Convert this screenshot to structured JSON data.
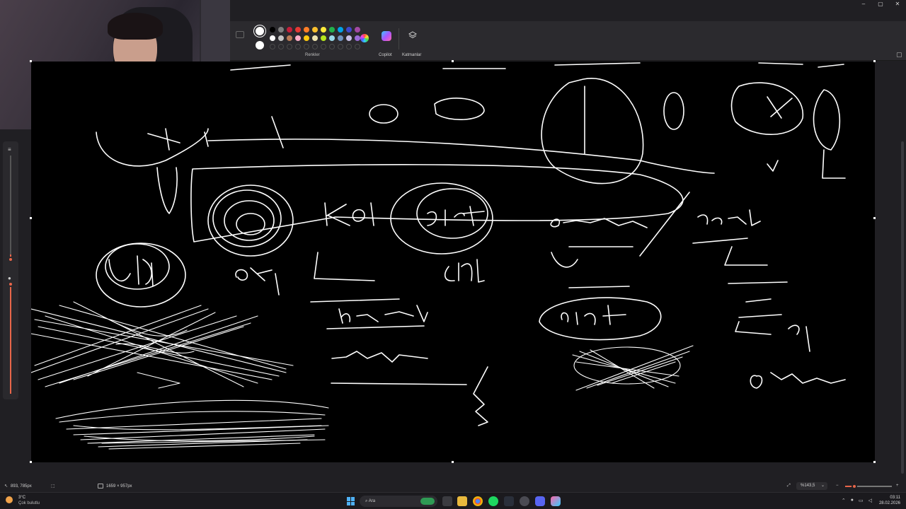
{
  "window": {
    "controls": [
      "–",
      "▢",
      "✕"
    ]
  },
  "ribbon": {
    "colors_label": "Renkler",
    "copilot_label": "Copilot",
    "layers_label": "Katmanlar",
    "palette": [
      "#000000",
      "#7f7f7f",
      "#c41e3a",
      "#e53935",
      "#ff7f27",
      "#fbc02d",
      "#ffeb3b",
      "#22b14c",
      "#00a2e8",
      "#3f48cc",
      "#a349a4",
      "#ffffff",
      "#c3c3c3",
      "#b97a57",
      "#ffaec9",
      "#ffc90e",
      "#efe4b0",
      "#b5e61d",
      "#99d9ea",
      "#7092be",
      "#c8bfe7",
      "#9c6cd8"
    ],
    "empty_slots": 11
  },
  "canvas": {
    "background": "#000000",
    "stroke": "#ffffff"
  },
  "statusbar": {
    "cursor_pos": "893, 785px",
    "canvas_size": "1659 × 957px",
    "zoom": "%143,5"
  },
  "taskbar": {
    "weather_temp": "3°C",
    "weather_desc": "Çok bulutlu",
    "search_placeholder": "Ara",
    "time": "03:11",
    "date": "28.02.2026"
  }
}
